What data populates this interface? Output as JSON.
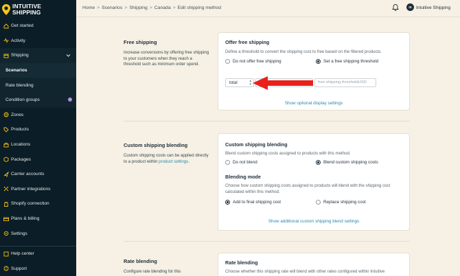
{
  "brand": {
    "line1": "INTUITIVE",
    "line2": "SHIPPING"
  },
  "sidebar": {
    "items": [
      {
        "label": "Get started",
        "icon": "home-icon"
      },
      {
        "label": "Activity",
        "icon": "activity-icon"
      },
      {
        "label": "Shipping",
        "icon": "shipping-icon"
      },
      {
        "label": "Scenarios"
      },
      {
        "label": "Rate blending"
      },
      {
        "label": "Condition groups",
        "badge": "i"
      },
      {
        "label": "Zones",
        "icon": "zones-icon"
      },
      {
        "label": "Products",
        "icon": "tag-icon"
      },
      {
        "label": "Locations",
        "icon": "location-icon"
      },
      {
        "label": "Packages",
        "icon": "package-icon"
      },
      {
        "label": "Carrier accounts",
        "icon": "carrier-icon"
      },
      {
        "label": "Partner integrations",
        "icon": "integration-icon"
      },
      {
        "label": "Shopify connection",
        "icon": "shopify-icon"
      },
      {
        "label": "Plans & billing",
        "icon": "billing-icon"
      },
      {
        "label": "Settings",
        "icon": "gear-icon"
      }
    ],
    "bottom": [
      {
        "label": "Help center",
        "icon": "help-icon"
      },
      {
        "label": "Support",
        "icon": "support-icon"
      }
    ]
  },
  "breadcrumb": [
    "Home",
    "Scenarios",
    "Shipping",
    "Canada",
    "Edit shipping method"
  ],
  "breadcrumb_sep": ">",
  "user": {
    "initials": "IS",
    "name": "Intuitive Shipping"
  },
  "free_shipping": {
    "title": "Free shipping",
    "description": "Increase conversions by offering free shipping to your customers when they reach a threshold such as minimum order spend.",
    "card_title": "Offer free shipping",
    "card_sub": "Define a threshold to convert the shipping cost to free based on the filtered products.",
    "option_no": "Do not offer free shipping",
    "option_yes": "Set a free shipping threshold",
    "select_value": "total",
    "threshold_placeholder": "free shipping threshold",
    "currency": "USD",
    "link": "Show optional display settings"
  },
  "custom_blending": {
    "title": "Custom shipping blending",
    "description_prefix": "Custom shipping costs can be applied directly to a product within ",
    "description_link": "product settings",
    "description_suffix": ".",
    "card_title": "Custom shipping blending",
    "card_sub": "Blend custom shipping costs assigned to products with this method.",
    "option_no": "Do not blend",
    "option_yes": "Blend custom shipping costs",
    "mode_title": "Blending mode",
    "mode_sub": "Choose how custom shipping costs assigned to products will blend with the shipping cost calculated within this method.",
    "mode_add": "Add to final shipping cost",
    "mode_replace": "Replace shipping cost",
    "link": "Show additional custom shipping blend settings"
  },
  "rate_blending": {
    "title": "Rate blending",
    "description": "Configure rate blending for this",
    "card_title": "Rate blending",
    "card_sub": "Choose whether this shipping rate will blend with other rates configured within Intuitive"
  },
  "colors": {
    "sidebar": "#0b1d26",
    "background": "#f6f1e4",
    "accent": "#2d87a9",
    "annotation": "#e8211b"
  }
}
